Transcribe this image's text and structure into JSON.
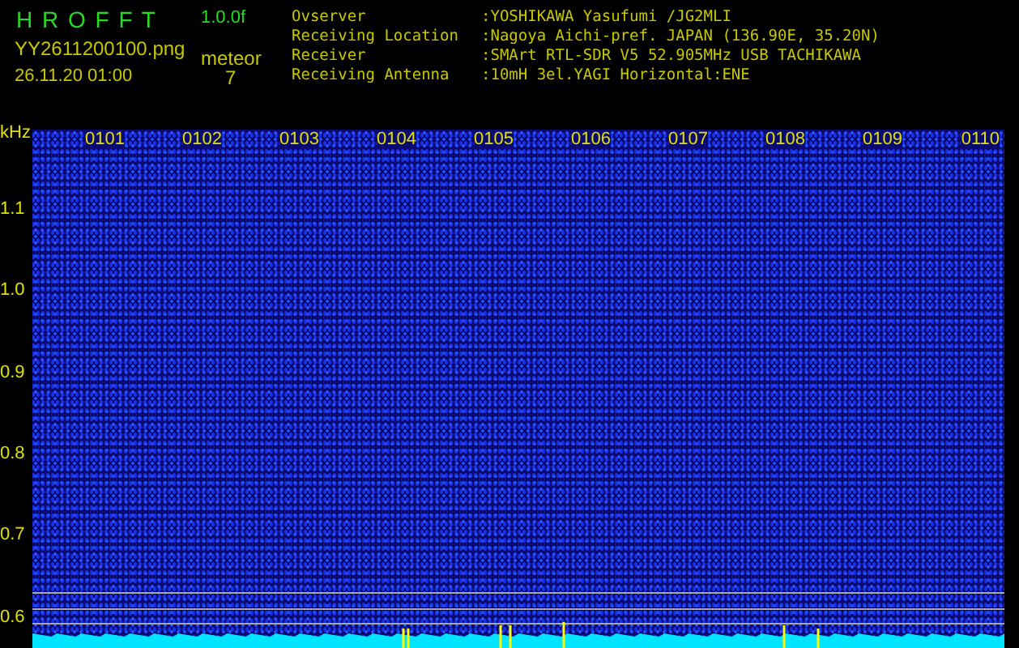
{
  "header": {
    "app_title": "H R O F F T",
    "version": "1.0.0f",
    "filename": "YY2611200100.png",
    "datetime": "26.11.20 01:00",
    "meteor_label": "meteor",
    "meteor_count": "7"
  },
  "info": [
    {
      "label": "Ovserver",
      "value": ":YOSHIKAWA Yasufumi /JG2MLI"
    },
    {
      "label": "Receiving Location",
      "value": ":Nagoya Aichi-pref. JAPAN (136.90E, 35.20N)"
    },
    {
      "label": "Receiver",
      "value": ":SMArt RTL-SDR V5 52.905MHz USB TACHIKAWA"
    },
    {
      "label": "Receiving Antenna",
      "value": ":10mH 3el.YAGI Horizontal:ENE"
    }
  ],
  "spectrogram": {
    "unit": "kHz",
    "y_labels": [
      "1.1",
      "1.0",
      "0.9",
      "0.8",
      "0.7",
      "0.6"
    ],
    "time_labels": [
      "0101",
      "0102",
      "0103",
      "0104",
      "0105",
      "0106",
      "0107",
      "0108",
      "0109",
      "0110"
    ]
  }
}
